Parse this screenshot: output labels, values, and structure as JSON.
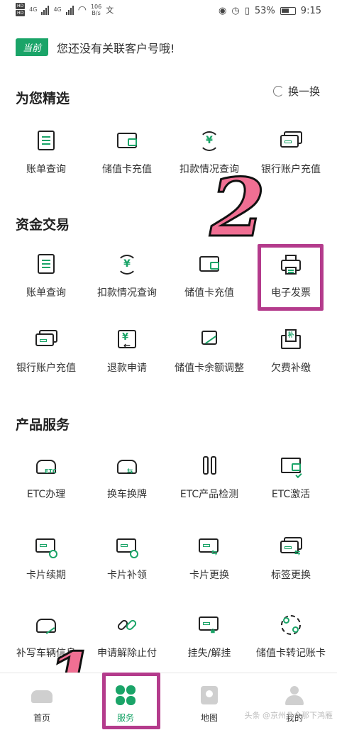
{
  "status_bar": {
    "hd1": "HD",
    "hd2": "HD",
    "net1": "4G",
    "net2": "4G",
    "speed_value": "106",
    "speed_unit": "B/s",
    "battery": "53%",
    "time": "9:15"
  },
  "account": {
    "badge": "当前",
    "message": "您还没有关联客户号哦!"
  },
  "featured": {
    "title": "为您精选",
    "refresh_label": "换一换",
    "items": [
      {
        "label": "账单查询",
        "icon": "bill-icon"
      },
      {
        "label": "储值卡充值",
        "icon": "wallet-icon"
      },
      {
        "label": "扣款情况查询",
        "icon": "yen-cycle-icon"
      },
      {
        "label": "银行账户充值",
        "icon": "bank-card-icon"
      }
    ]
  },
  "funds": {
    "title": "资金交易",
    "items": [
      {
        "label": "账单查询",
        "icon": "bill-icon"
      },
      {
        "label": "扣款情况查询",
        "icon": "yen-cycle-icon"
      },
      {
        "label": "储值卡充值",
        "icon": "wallet-icon"
      },
      {
        "label": "电子发票",
        "icon": "printer-icon"
      },
      {
        "label": "银行账户充值",
        "icon": "bank-card-icon"
      },
      {
        "label": "退款申请",
        "icon": "refund-icon"
      },
      {
        "label": "储值卡余额调整",
        "icon": "balance-adjust-icon"
      },
      {
        "label": "欠费补缴",
        "icon": "arrears-envelope-icon"
      }
    ]
  },
  "products": {
    "title": "产品服务",
    "items": [
      {
        "label": "ETC办理",
        "icon": "etc-car-icon"
      },
      {
        "label": "换车换牌",
        "icon": "car-swap-icon"
      },
      {
        "label": "ETC产品检测",
        "icon": "tools-icon"
      },
      {
        "label": "ETC激活",
        "icon": "device-check-icon"
      },
      {
        "label": "卡片续期",
        "icon": "card-renew-icon"
      },
      {
        "label": "卡片补领",
        "icon": "card-reissue-icon"
      },
      {
        "label": "卡片更换",
        "icon": "card-swap-icon"
      },
      {
        "label": "标签更换",
        "icon": "tag-swap-icon"
      },
      {
        "label": "补写车辆信息",
        "icon": "car-edit-icon"
      },
      {
        "label": "申请解除止付",
        "icon": "unlink-icon"
      },
      {
        "label": "挂失/解挂",
        "icon": "card-lock-icon"
      },
      {
        "label": "储值卡转记账卡",
        "icon": "card-convert-icon"
      }
    ],
    "car_tag": "ETC"
  },
  "annotations": {
    "number_one": "1",
    "number_two": "2",
    "highlight_color": "#b43b8c"
  },
  "bottom_nav": {
    "items": [
      {
        "label": "首页",
        "icon": "home-car-icon"
      },
      {
        "label": "服务",
        "icon": "clover-icon"
      },
      {
        "label": "地图",
        "icon": "map-pin-icon"
      },
      {
        "label": "我的",
        "icon": "person-icon"
      }
    ]
  },
  "watermark": "头条 @京州几今那下鸿雁",
  "colors": {
    "accent": "#1aa468",
    "text": "#333333"
  }
}
